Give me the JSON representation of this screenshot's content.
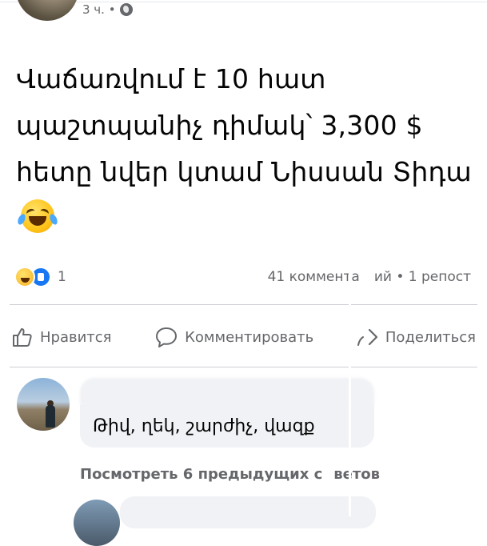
{
  "post": {
    "time": "3 ч. •",
    "text_main": "Վաճառվում է 10 հատ պաշտպանիչ դիմակ՝ 3,300 $ հետը նվեր կտամ Նիսսան Տիդա",
    "emoji": "laughing-with-tears"
  },
  "engagement": {
    "reaction_count": "1",
    "comments": "41 коммента",
    "comments_rest": "ий",
    "reposts": "• 1 репост"
  },
  "actions": {
    "like": "Нравится",
    "comment": "Комментировать",
    "share": "Поделиться"
  },
  "comments": {
    "first_text": "Թիվ, ղեկ, շարժիչ, վազք",
    "view_more_part1": "Посмотреть 6 предыдущих с",
    "view_more_part2": "ветов"
  },
  "colors": {
    "secondary_text": "#65676b",
    "like_blue": "#1877f2",
    "bubble_bg": "#f0f2f5"
  }
}
